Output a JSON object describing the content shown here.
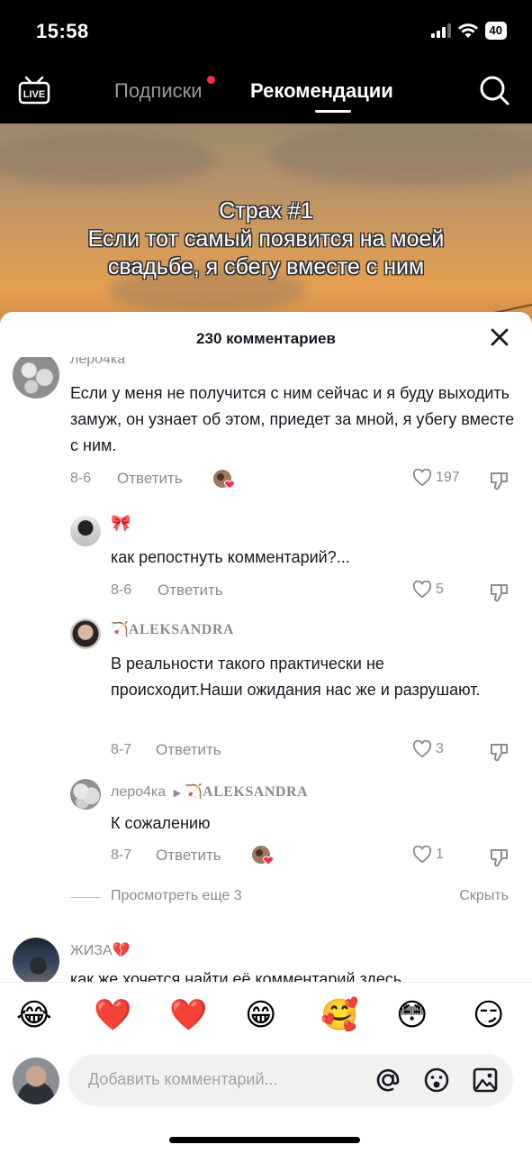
{
  "status": {
    "time": "15:58",
    "battery": "40"
  },
  "nav": {
    "live_label": "LIVE",
    "tab_following": "Подписки",
    "tab_foryou": "Рекомендации"
  },
  "video": {
    "caption_line1": "Страх #1",
    "caption_line2": "Если тот самый появится на моей",
    "caption_line3": "свадьбе, я сбегу вместе с ним"
  },
  "sheet": {
    "title": "230 комментариев"
  },
  "comments": [
    {
      "user": "леро4ка",
      "text": "Если у меня не получится с ним сейчас и я буду выходить замуж, он узнает об этом, приедет за мной, я убегу вместе с ним.",
      "date": "8-6",
      "reply": "Ответить",
      "likes": "197"
    },
    {
      "user": "🎀",
      "text": "как репостнуть комментарий?...",
      "date": "8-6",
      "reply": "Ответить",
      "likes": "5"
    },
    {
      "user_icon": "🏹",
      "user": "ALEKSANDRA",
      "text": "В реальности такого практически не происходит.Наши ожидания нас же и разрушают.",
      "date": "8-7",
      "reply": "Ответить",
      "likes": "3"
    },
    {
      "user": "леро4ка",
      "reply_to_icon": "🏹",
      "reply_to": "ALEKSANDRA",
      "text": "К сожалению",
      "date": "8-7",
      "reply": "Ответить",
      "likes": "1"
    },
    {
      "user": "ЖИЗА💔",
      "text": "как же хочется найти её комментарий здесь.."
    }
  ],
  "more": {
    "view_more": "Просмотреть еще 3",
    "hide": "Скрыть"
  },
  "emojis": [
    "😂",
    "❤️",
    "❤️",
    "😁",
    "🥰",
    "😳",
    "😏"
  ],
  "input": {
    "placeholder": "Добавить комментарий..."
  },
  "colors": {
    "accent_red": "#fe2c55",
    "text": "#161823",
    "muted": "#8a8b91"
  }
}
